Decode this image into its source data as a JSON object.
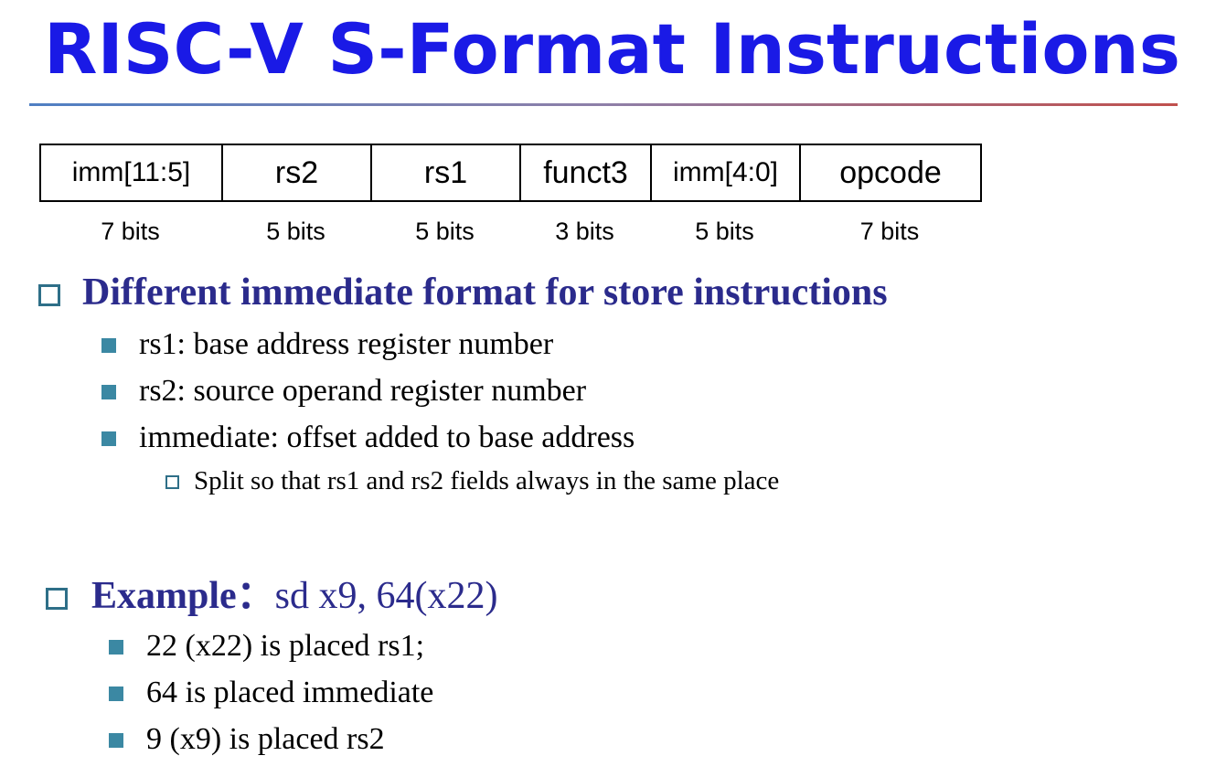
{
  "title": "RISC-V S-Format Instructions",
  "format": {
    "fields": [
      "imm[11:5]",
      "rs2",
      "rs1",
      "funct3",
      "imm[4:0]",
      "opcode"
    ],
    "bits": [
      "7 bits",
      "5 bits",
      "5 bits",
      "3 bits",
      "5 bits",
      "7 bits"
    ]
  },
  "points": [
    {
      "text": "Different immediate format for store instructions",
      "items": [
        "rs1: base address register number",
        "rs2: source operand register number",
        "immediate: offset added to base address"
      ],
      "subitems": [
        "Split so that rs1 and rs2 fields always in the same place"
      ]
    }
  ],
  "example": {
    "label": "Example：",
    "code": "sd x9, 64(x22)",
    "items": [
      "22 (x22) is placed rs1;",
      "64 is placed immediate",
      "9 (x9) is placed rs2"
    ]
  },
  "colors": {
    "title": "#1a1ae6",
    "heading": "#2b2b8c",
    "bullet": "#3b88a3"
  }
}
